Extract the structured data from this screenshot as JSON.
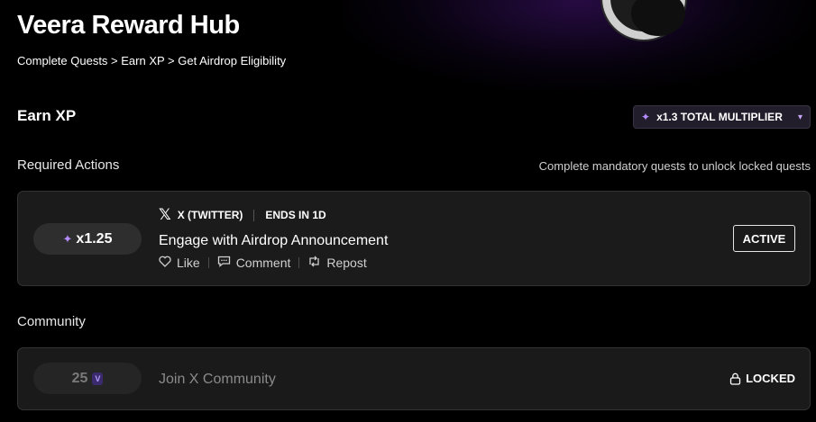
{
  "hero": {
    "title": "Veera Reward Hub",
    "breadcrumb": "Complete Quests > Earn XP > Get Airdrop Eligibility"
  },
  "earn": {
    "title": "Earn XP",
    "multiplier_label": "x1.3 TOTAL MULTIPLIER",
    "multiplier_icon": "sparkle-icon"
  },
  "required": {
    "title": "Required Actions",
    "note": "Complete mandatory quests to unlock locked quests",
    "quest": {
      "multiplier": "x1.25",
      "platform": "X (TWITTER)",
      "ends": "ENDS IN 1D",
      "title": "Engage with Airdrop Announcement",
      "actions": [
        "Like",
        "Comment",
        "Repost"
      ],
      "status": "ACTIVE"
    }
  },
  "community": {
    "title": "Community",
    "quest": {
      "xp": "25",
      "title": "Join X Community",
      "status": "LOCKED"
    }
  },
  "colors": {
    "background": "#000000",
    "card": "#1b1b1b",
    "accent": "#b68cff"
  }
}
